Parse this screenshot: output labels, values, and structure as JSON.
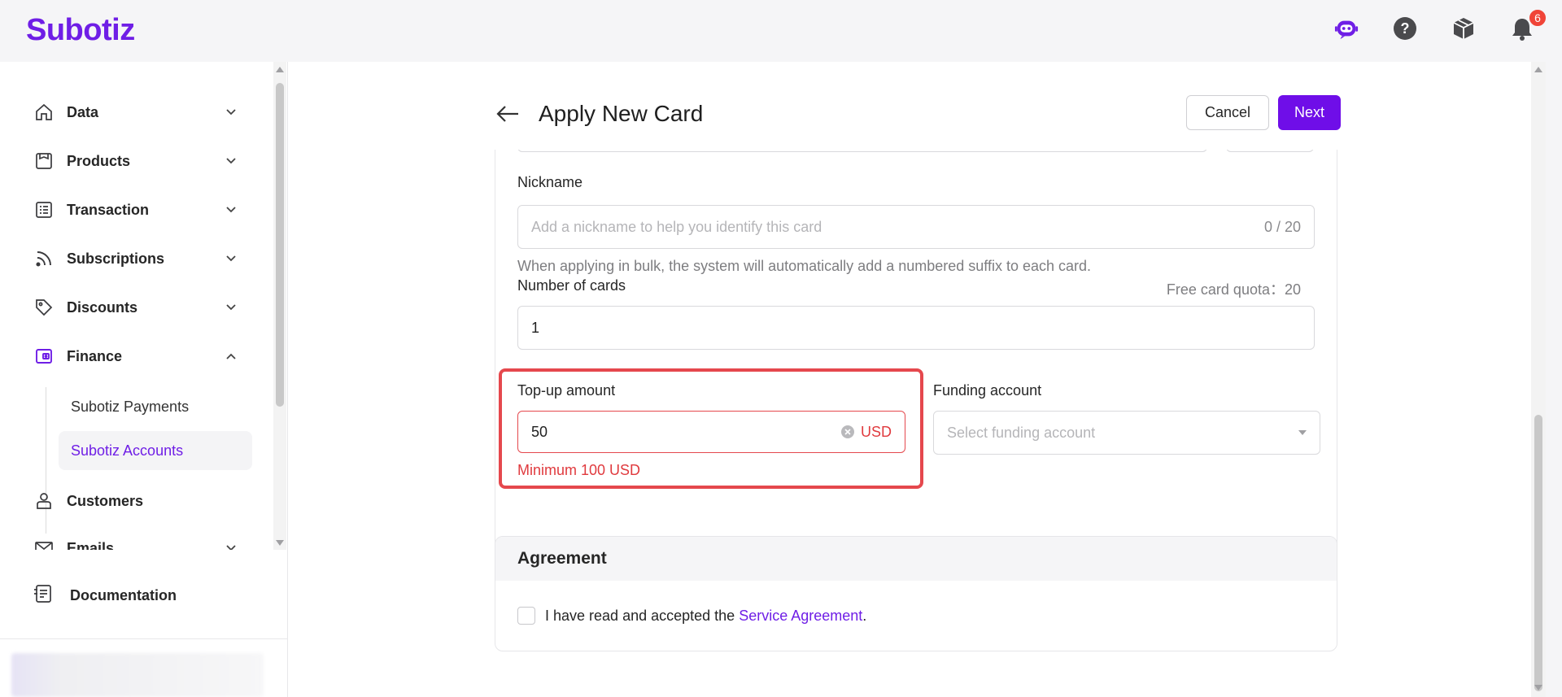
{
  "app": {
    "logo": "Subotiz",
    "notification_count": "6"
  },
  "sidebar": {
    "items": [
      {
        "label": "Data",
        "icon": "home-icon"
      },
      {
        "label": "Products",
        "icon": "store-icon"
      },
      {
        "label": "Transaction",
        "icon": "list-icon"
      },
      {
        "label": "Subscriptions",
        "icon": "rss-icon"
      },
      {
        "label": "Discounts",
        "icon": "tag-icon"
      },
      {
        "label": "Finance",
        "icon": "wallet-icon"
      },
      {
        "label": "Customers",
        "icon": "user-icon"
      },
      {
        "label": "Emails",
        "icon": "mail-icon"
      }
    ],
    "finance_sub": [
      "Subotiz Payments",
      "Subotiz Accounts"
    ],
    "documentation": "Documentation"
  },
  "header": {
    "title": "Apply New Card",
    "cancel": "Cancel",
    "next": "Next"
  },
  "form": {
    "nickname": {
      "label": "Nickname",
      "placeholder": "Add a nickname to help you identify this card",
      "counter": "0 / 20",
      "hint": "When applying in bulk, the system will automatically add a numbered suffix to each card."
    },
    "cards": {
      "label": "Number of cards",
      "quota": "Free card quota：20",
      "value": "1"
    },
    "topup": {
      "label": "Top-up amount",
      "value": "50",
      "currency": "USD",
      "error": "Minimum 100 USD"
    },
    "funding": {
      "label": "Funding account",
      "placeholder": "Select funding account"
    }
  },
  "agreement": {
    "title": "Agreement",
    "text": "I have read and accepted the ",
    "link": "Service Agreement",
    "suffix": "."
  },
  "colors": {
    "brand": "#6f1ee6",
    "error": "#e5484d"
  }
}
